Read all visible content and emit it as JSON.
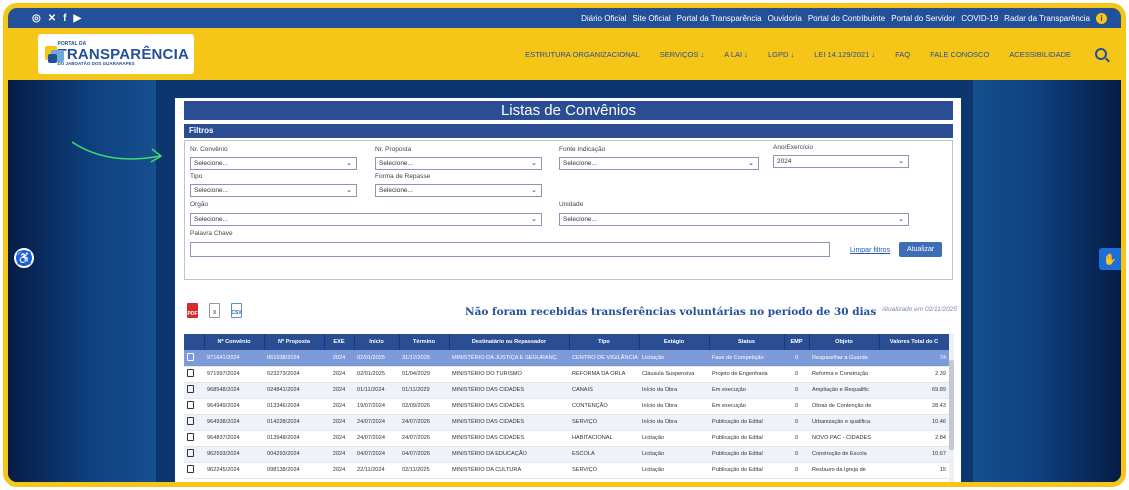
{
  "topbar": {
    "social": [
      "◎",
      "✕",
      "f",
      "▶"
    ],
    "links": [
      "Diário Oficial",
      "Site Oficial",
      "Portal da Transparência",
      "Ouvidoria",
      "Portal do Contribuinte",
      "Portal do Servidor",
      "COVID-19",
      "Radar da Transparência"
    ],
    "info_badge": "i"
  },
  "logo": {
    "small": "PORTAL DA",
    "big": "TRANSPARÊNCIA",
    "sub": "DO JABOATÃO DOS GUARARAPES"
  },
  "menu": [
    "ESTRUTURA ORGANIZACIONAL",
    "SERVIÇOS ↓",
    "A LAI ↓",
    "LGPD ↓",
    "LEI 14.129/2021 ↓",
    "FAQ",
    "FALE CONOSCO",
    "ACESSIBILIDADE"
  ],
  "page": {
    "title": "Listas de Convênios",
    "filters_title": "Filtros",
    "notice": "Não foram recebidas transferências voluntárias no período de 30 dias",
    "updated": "Atualizado em 02/11/2025"
  },
  "filters": {
    "nr_convenio": {
      "label": "Nr. Convênio",
      "value": "Selecione..."
    },
    "nr_proposta": {
      "label": "Nr. Proposta",
      "value": "Selecione..."
    },
    "fonte": {
      "label": "Fonte Indicação",
      "value": "Selecione..."
    },
    "ano": {
      "label": "Ano/Exercício",
      "value": "2024"
    },
    "tipo": {
      "label": "Tipo",
      "value": "Selecione..."
    },
    "forma": {
      "label": "Forma de Repasse",
      "value": "Selecione..."
    },
    "orgao": {
      "label": "Orgão",
      "value": "Selecione..."
    },
    "unidade": {
      "label": "Unidade",
      "value": "Selecione..."
    },
    "palavra": {
      "label": "Palavra Chave",
      "value": ""
    },
    "clear": "Limpar filtros",
    "update": "Atualizar"
  },
  "export": {
    "pdf": "PDF",
    "xls": "X",
    "csv": "CSV"
  },
  "table": {
    "headers": [
      "",
      "Nº Convênio",
      "Nº Proposta",
      "EXE",
      "Início",
      "Término",
      "Destinatário ou Repassador",
      "Tipo",
      "Estágio",
      "Status",
      "EMP",
      "Objeto",
      "Valores Total do C"
    ],
    "rows": [
      [
        "",
        "971641/2024",
        "061938/2024",
        "2024",
        "02/01/2025",
        "31/12/2025",
        "MINISTÉRIO DA JUSTIÇA E SEGURANÇ",
        "CENTRO DE VIGILÂNCIA",
        "Licitação",
        "Fase de Competição",
        "0",
        "Reaparelhar a Guarda",
        "74"
      ],
      [
        "",
        "971997/2024",
        "023273/2024",
        "2024",
        "02/01/2025",
        "01/04/2029",
        "MINISTÉRIO DO TURISMO",
        "REFORMA DA ORLA",
        "Cláusula Suspensiva",
        "Projeto de Engenharia",
        "0",
        "Reforma e Construção",
        "2.39"
      ],
      [
        "",
        "968548/2024",
        "024841/2024",
        "2024",
        "01/11/2024",
        "01/11/2029",
        "MINISTÉRIO DAS CIDADES",
        "CANAIS",
        "Início da Obra",
        "Em execução",
        "0",
        "Ampliação e Requalific",
        "69.89"
      ],
      [
        "",
        "964949/2024",
        "013346/2024",
        "2024",
        "19/07/2024",
        "02/09/2026",
        "MINISTÉRIO DAS CIDADES",
        "CONTENÇÃO",
        "Início da Obra",
        "Em execução",
        "0",
        "Obras de Contenção de",
        "28.43"
      ],
      [
        "",
        "964938/2024",
        "014228/2024",
        "2024",
        "24/07/2024",
        "24/07/2026",
        "MINISTÉRIO DAS CIDADES",
        "SERVIÇO",
        "Início da Obra",
        "Publicação do Edital",
        "0",
        "Urbanização e qualifica",
        "10.46"
      ],
      [
        "",
        "964837/2024",
        "013948/2024",
        "2024",
        "24/07/2024",
        "24/07/2026",
        "MINISTÉRIO DAS CIDADES",
        "HABITACIONAL",
        "Licitação",
        "Publicação do Edital",
        "0",
        "NOVO PAC - CIDADES",
        "2.84"
      ],
      [
        "",
        "962593/2024",
        "004293/2024",
        "2024",
        "04/07/2024",
        "04/07/2026",
        "MINISTÉRIO DA EDUCAÇÃO",
        "ESCOLA",
        "Licitação",
        "Publicação do Edital",
        "0",
        "Construção de Escola",
        "10.67"
      ],
      [
        "",
        "962245/2024",
        "098138/2024",
        "2024",
        "22/11/2024",
        "02/11/2025",
        "MINISTÉRIO DA CULTURA",
        "SERVIÇO",
        "Licitação",
        "Publicação do Edital",
        "0",
        "Restauro da Igreja de",
        "15"
      ]
    ]
  },
  "icons": {
    "accessibility": "♿",
    "vlibras": "✋",
    "menu_chevron": "↓",
    "select_chevron": "⌄"
  },
  "colors": {
    "brand_yellow": "#f5c518",
    "brand_blue": "#24509a",
    "header_blue": "#2b4d94",
    "selected_row": "#7d9bd9"
  }
}
